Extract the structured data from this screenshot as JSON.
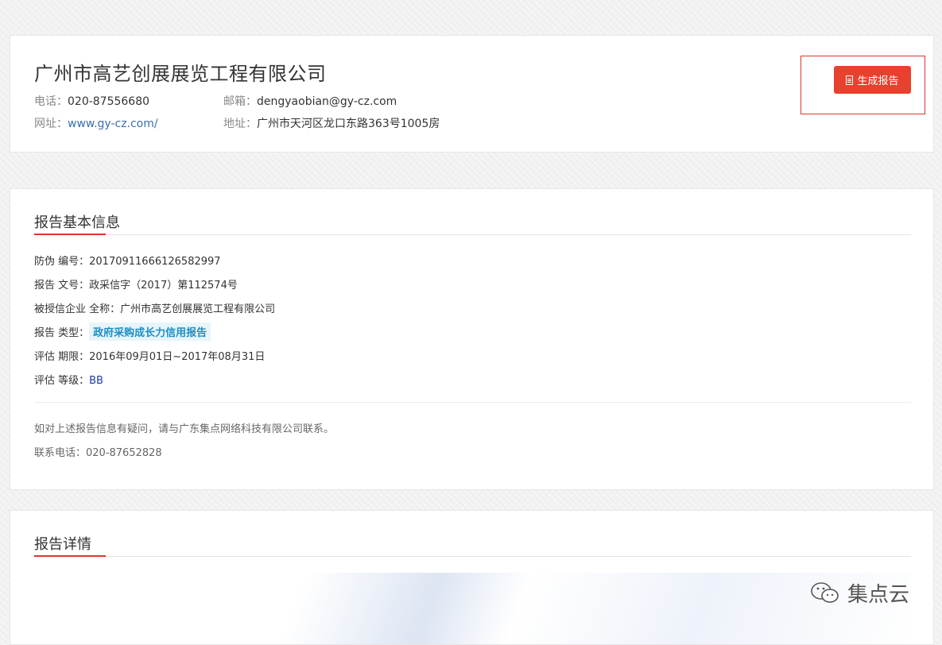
{
  "company": {
    "name": "广州市高艺创展展览工程有限公司",
    "phone_label": "电话：",
    "phone": "020-87556680",
    "email_label": "邮箱：",
    "email": "dengyaobian@gy-cz.com",
    "website_label": "网址：",
    "website": "www.gy-cz.com/",
    "address_label": "地址：",
    "address": "广州市天河区龙口东路363号1005房"
  },
  "actions": {
    "generate_report_label": "生成报告"
  },
  "basic_info": {
    "title": "报告基本信息",
    "fields": [
      {
        "label": "防伪 编号：",
        "value": "20170911666126582997"
      },
      {
        "label": "报告 文号：",
        "value": "政采信字（2017）第112574号"
      },
      {
        "label": "被授信企业 全称：",
        "value": "广州市高艺创展展览工程有限公司"
      },
      {
        "label": "报告 类型：",
        "value": "政府采购成长力信用报告"
      },
      {
        "label": "评估 期限：",
        "value": "2016年09月01日~2017年08月31日"
      },
      {
        "label": "评估 等级：",
        "value": "BB"
      }
    ],
    "note": "如对上述报告信息有疑问，请与广东集点网络科技有限公司联系。",
    "contact_label": "联系电话：",
    "contact_phone": "020-87652828"
  },
  "detail": {
    "title": "报告详情"
  },
  "watermark": {
    "text": "集点云"
  }
}
